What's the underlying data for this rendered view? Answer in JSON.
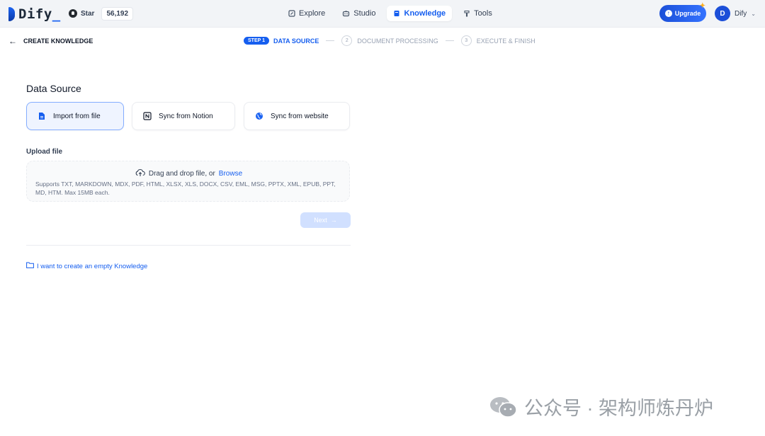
{
  "app": {
    "logo_text": "Dify",
    "logo_suffix": "_",
    "github_star_label": "Star",
    "github_star_count": "56,192"
  },
  "nav": {
    "items": [
      {
        "label": "Explore",
        "icon": "explore-icon"
      },
      {
        "label": "Studio",
        "icon": "studio-icon"
      },
      {
        "label": "Knowledge",
        "icon": "knowledge-icon",
        "active": true
      },
      {
        "label": "Tools",
        "icon": "tools-icon"
      }
    ]
  },
  "account": {
    "upgrade_label": "Upgrade",
    "avatar_initial": "D",
    "workspace_name": "Dify"
  },
  "subheader": {
    "back_label": "CREATE KNOWLEDGE",
    "steps": [
      {
        "badge": "STEP 1",
        "label": "DATA SOURCE",
        "state": "active"
      },
      {
        "number": "2",
        "label": "DOCUMENT PROCESSING",
        "state": "inactive"
      },
      {
        "number": "3",
        "label": "EXECUTE & FINISH",
        "state": "inactive"
      }
    ]
  },
  "data_source": {
    "title": "Data Source",
    "options": [
      {
        "label": "Import from file",
        "icon": "file-icon",
        "selected": true
      },
      {
        "label": "Sync from Notion",
        "icon": "notion-icon",
        "selected": false
      },
      {
        "label": "Sync from website",
        "icon": "website-icon",
        "selected": false
      }
    ]
  },
  "upload": {
    "label": "Upload file",
    "drop_text": "Drag and drop file, or",
    "browse_label": "Browse",
    "supported_text": "Supports TXT, MARKDOWN, MDX, PDF, HTML, XLSX, XLS, DOCX, CSV, EML, MSG, PPTX, XML, EPUB, PPT, MD, HTM. Max 15MB each."
  },
  "actions": {
    "next_label": "Next",
    "empty_knowledge_label": "I want to create an empty Knowledge"
  },
  "watermark": {
    "text": "公众号 · 架构师炼丹炉"
  },
  "colors": {
    "accent": "#155eef",
    "selected_bg": "#eff4ff",
    "next_disabled": "#d1e0ff"
  }
}
